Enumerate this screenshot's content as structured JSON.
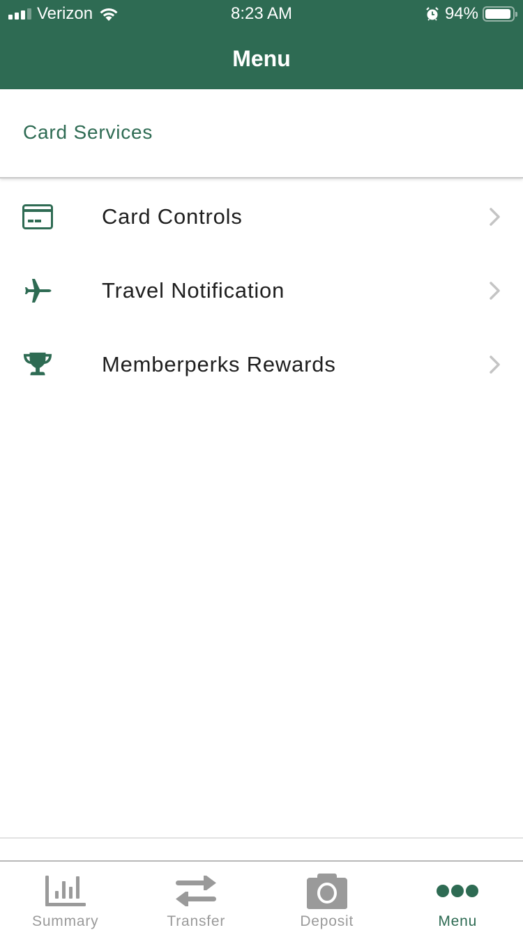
{
  "status_bar": {
    "carrier": "Verizon",
    "time": "8:23 AM",
    "battery_percent": "94%",
    "battery_level": 0.94,
    "signal_bars_active": 3,
    "signal_bars_total": 4,
    "icons": [
      "signal-icon",
      "wifi-icon",
      "alarm-icon",
      "battery-icon"
    ]
  },
  "header": {
    "title": "Menu"
  },
  "section": {
    "title": "Card Services"
  },
  "menu_items": [
    {
      "label": "Card Controls",
      "icon": "credit-card-icon"
    },
    {
      "label": "Travel Notification",
      "icon": "airplane-icon"
    },
    {
      "label": "Memberperks Rewards",
      "icon": "trophy-icon"
    }
  ],
  "tab_bar": {
    "tabs": [
      {
        "label": "Summary",
        "icon": "bar-chart-icon",
        "active": false
      },
      {
        "label": "Transfer",
        "icon": "transfer-arrows-icon",
        "active": false
      },
      {
        "label": "Deposit",
        "icon": "camera-icon",
        "active": false
      },
      {
        "label": "Menu",
        "icon": "more-dots-icon",
        "active": true
      }
    ]
  },
  "colors": {
    "brand": "#2e6b53",
    "tab_inactive": "#9a9a9a",
    "chevron": "#c4c4c4",
    "text": "#1e1e1e"
  }
}
